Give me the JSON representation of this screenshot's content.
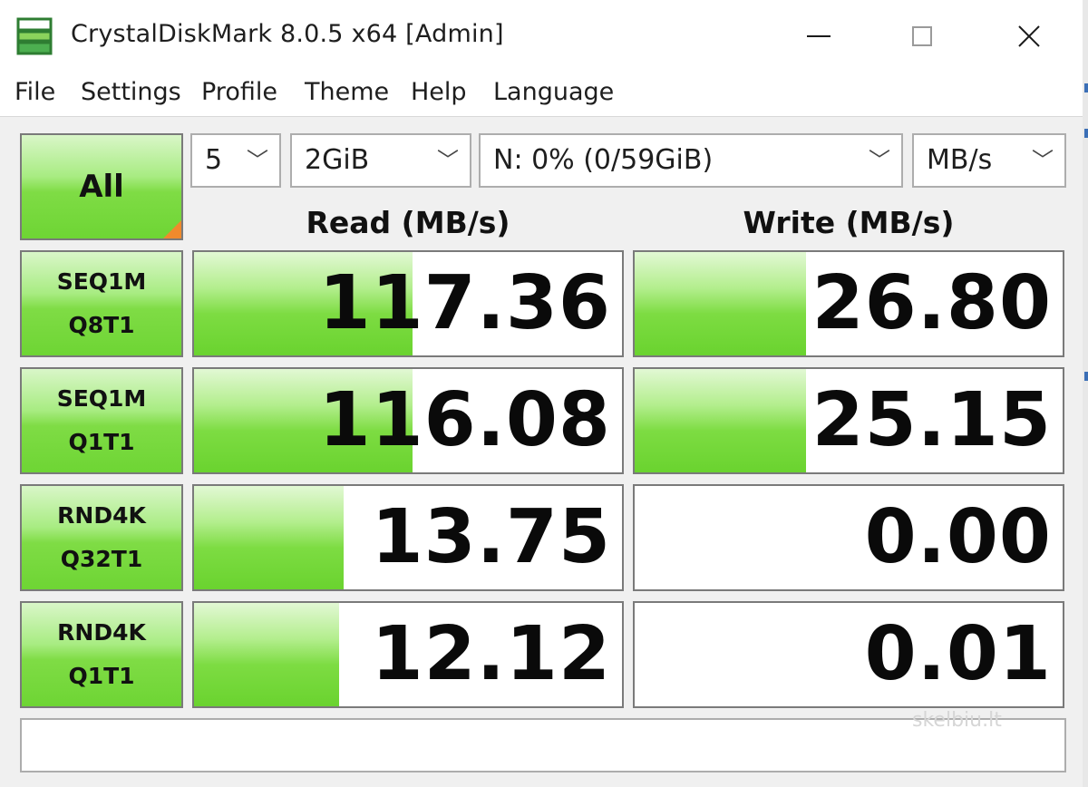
{
  "window": {
    "title": "CrystalDiskMark 8.0.5 x64 [Admin]",
    "close_glyph": "✕"
  },
  "menu": [
    "File",
    "Settings",
    "Profile",
    "Theme",
    "Help",
    "Language"
  ],
  "controls": {
    "all_label": "All",
    "count": "5",
    "size": "2GiB",
    "drive": "N: 0% (0/59GiB)",
    "unit": "MB/s",
    "chevron": "﹀"
  },
  "headers": {
    "read": "Read (MB/s)",
    "write": "Write (MB/s)"
  },
  "tests": [
    {
      "line1": "SEQ1M",
      "line2": "Q8T1",
      "read": "117.36",
      "write": "26.80",
      "read_fill": 0.51,
      "write_fill": 0.4
    },
    {
      "line1": "SEQ1M",
      "line2": "Q1T1",
      "read": "116.08",
      "write": "25.15",
      "read_fill": 0.51,
      "write_fill": 0.4
    },
    {
      "line1": "RND4K",
      "line2": "Q32T1",
      "read": "13.75",
      "write": "0.00",
      "read_fill": 0.35,
      "write_fill": 0
    },
    {
      "line1": "RND4K",
      "line2": "Q1T1",
      "read": "12.12",
      "write": "0.01",
      "read_fill": 0.34,
      "write_fill": 0
    }
  ],
  "comment": "",
  "watermark": "skelbiu.lt",
  "colors": {
    "bar_green": "#6ad32f",
    "corner_orange": "#f08a2c"
  }
}
